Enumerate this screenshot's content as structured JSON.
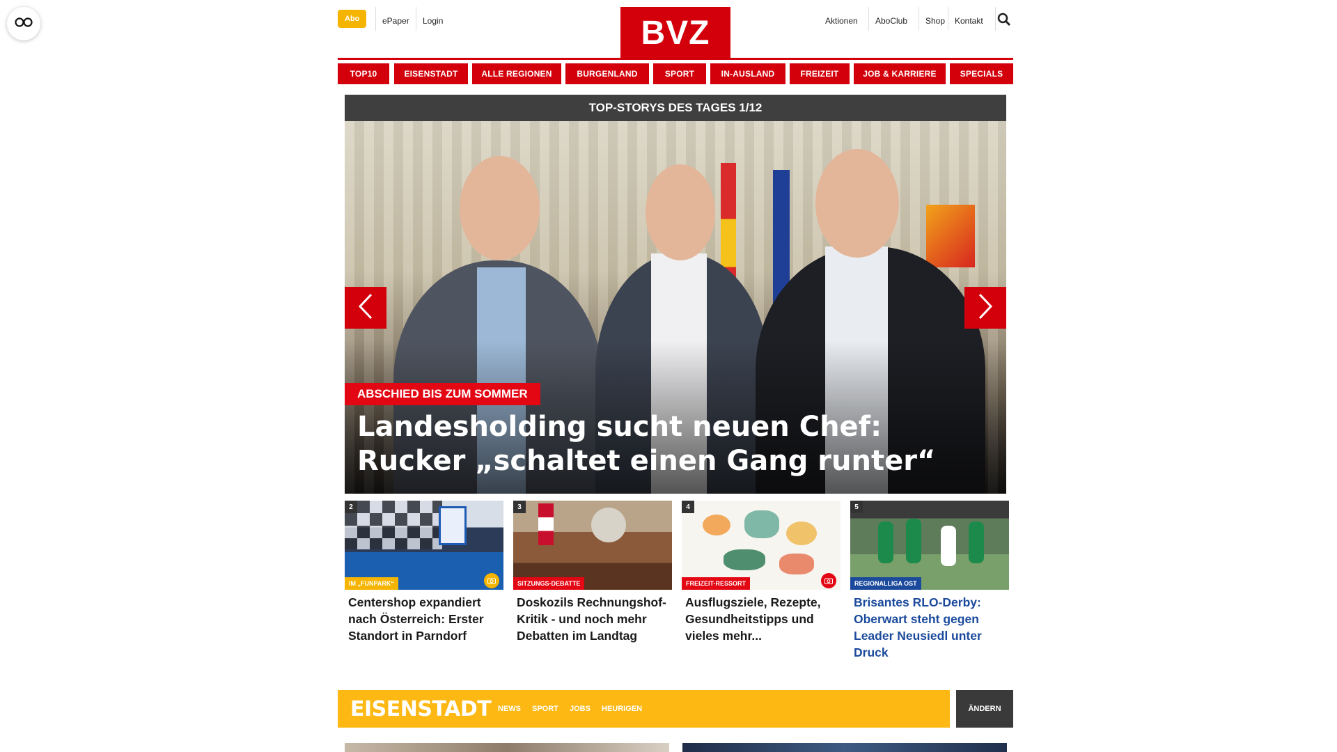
{
  "floating": {
    "icon": "glasses-icon"
  },
  "topbar": {
    "abo": "Abo",
    "left_links": [
      "ePaper",
      "Login"
    ],
    "logo": "BVZ",
    "right_links": [
      "Aktionen",
      "AboClub",
      "Shop",
      "Kontakt"
    ],
    "search_icon": "search-icon"
  },
  "nav": [
    "TOP10",
    "EISENSTADT",
    "ALLE REGIONEN",
    "BURGENLAND",
    "SPORT",
    "IN-AUSLAND",
    "FREIZEIT",
    "JOB & KARRIERE",
    "SPECIALS"
  ],
  "topstories": {
    "header": "TOP-STORYS DES TAGES 1/12",
    "main": {
      "kicker": "ABSCHIED BIS ZUM SOMMER",
      "headline": "Landesholding sucht neuen Chef: Rucker „schaltet einen Gang runter“"
    },
    "teasers": [
      {
        "num": "2",
        "tag": "IM „FUNPARK“",
        "tag_color": "#f5b400",
        "title": "Centershop expandiert nach Österreich: Erster Standort in Parndorf",
        "camera": true,
        "camera_color": "#f5b400"
      },
      {
        "num": "3",
        "tag": "SITZUNGS-DEBATTE",
        "tag_color": "#e30613",
        "title": "Doskozils Rechnungshof-Kritik - und noch mehr Debatten im Landtag",
        "camera": false
      },
      {
        "num": "4",
        "tag": "FREIZEIT-RESSORT",
        "tag_color": "#e30613",
        "title": "Ausflugsziele, Rezepte, Gesundheitstipps und vieles mehr...",
        "camera": true,
        "camera_color": "#e30613"
      },
      {
        "num": "5",
        "tag": "REGIONALLIGA OST",
        "tag_color": "#1b4a9c",
        "title": "Brisantes RLO-Derby: Oberwart steht gegen Leader Neusiedl unter Druck",
        "camera": false
      }
    ]
  },
  "region": {
    "title": "EISENSTADT",
    "links": [
      "NEWS",
      "SPORT",
      "JOBS",
      "HEURIGEN"
    ],
    "change": "ÄNDERN"
  },
  "colors": {
    "brand_red": "#d3000b",
    "accent_yellow": "#fdb813",
    "dark": "#3f3f3f",
    "blue": "#1b4a9c"
  }
}
